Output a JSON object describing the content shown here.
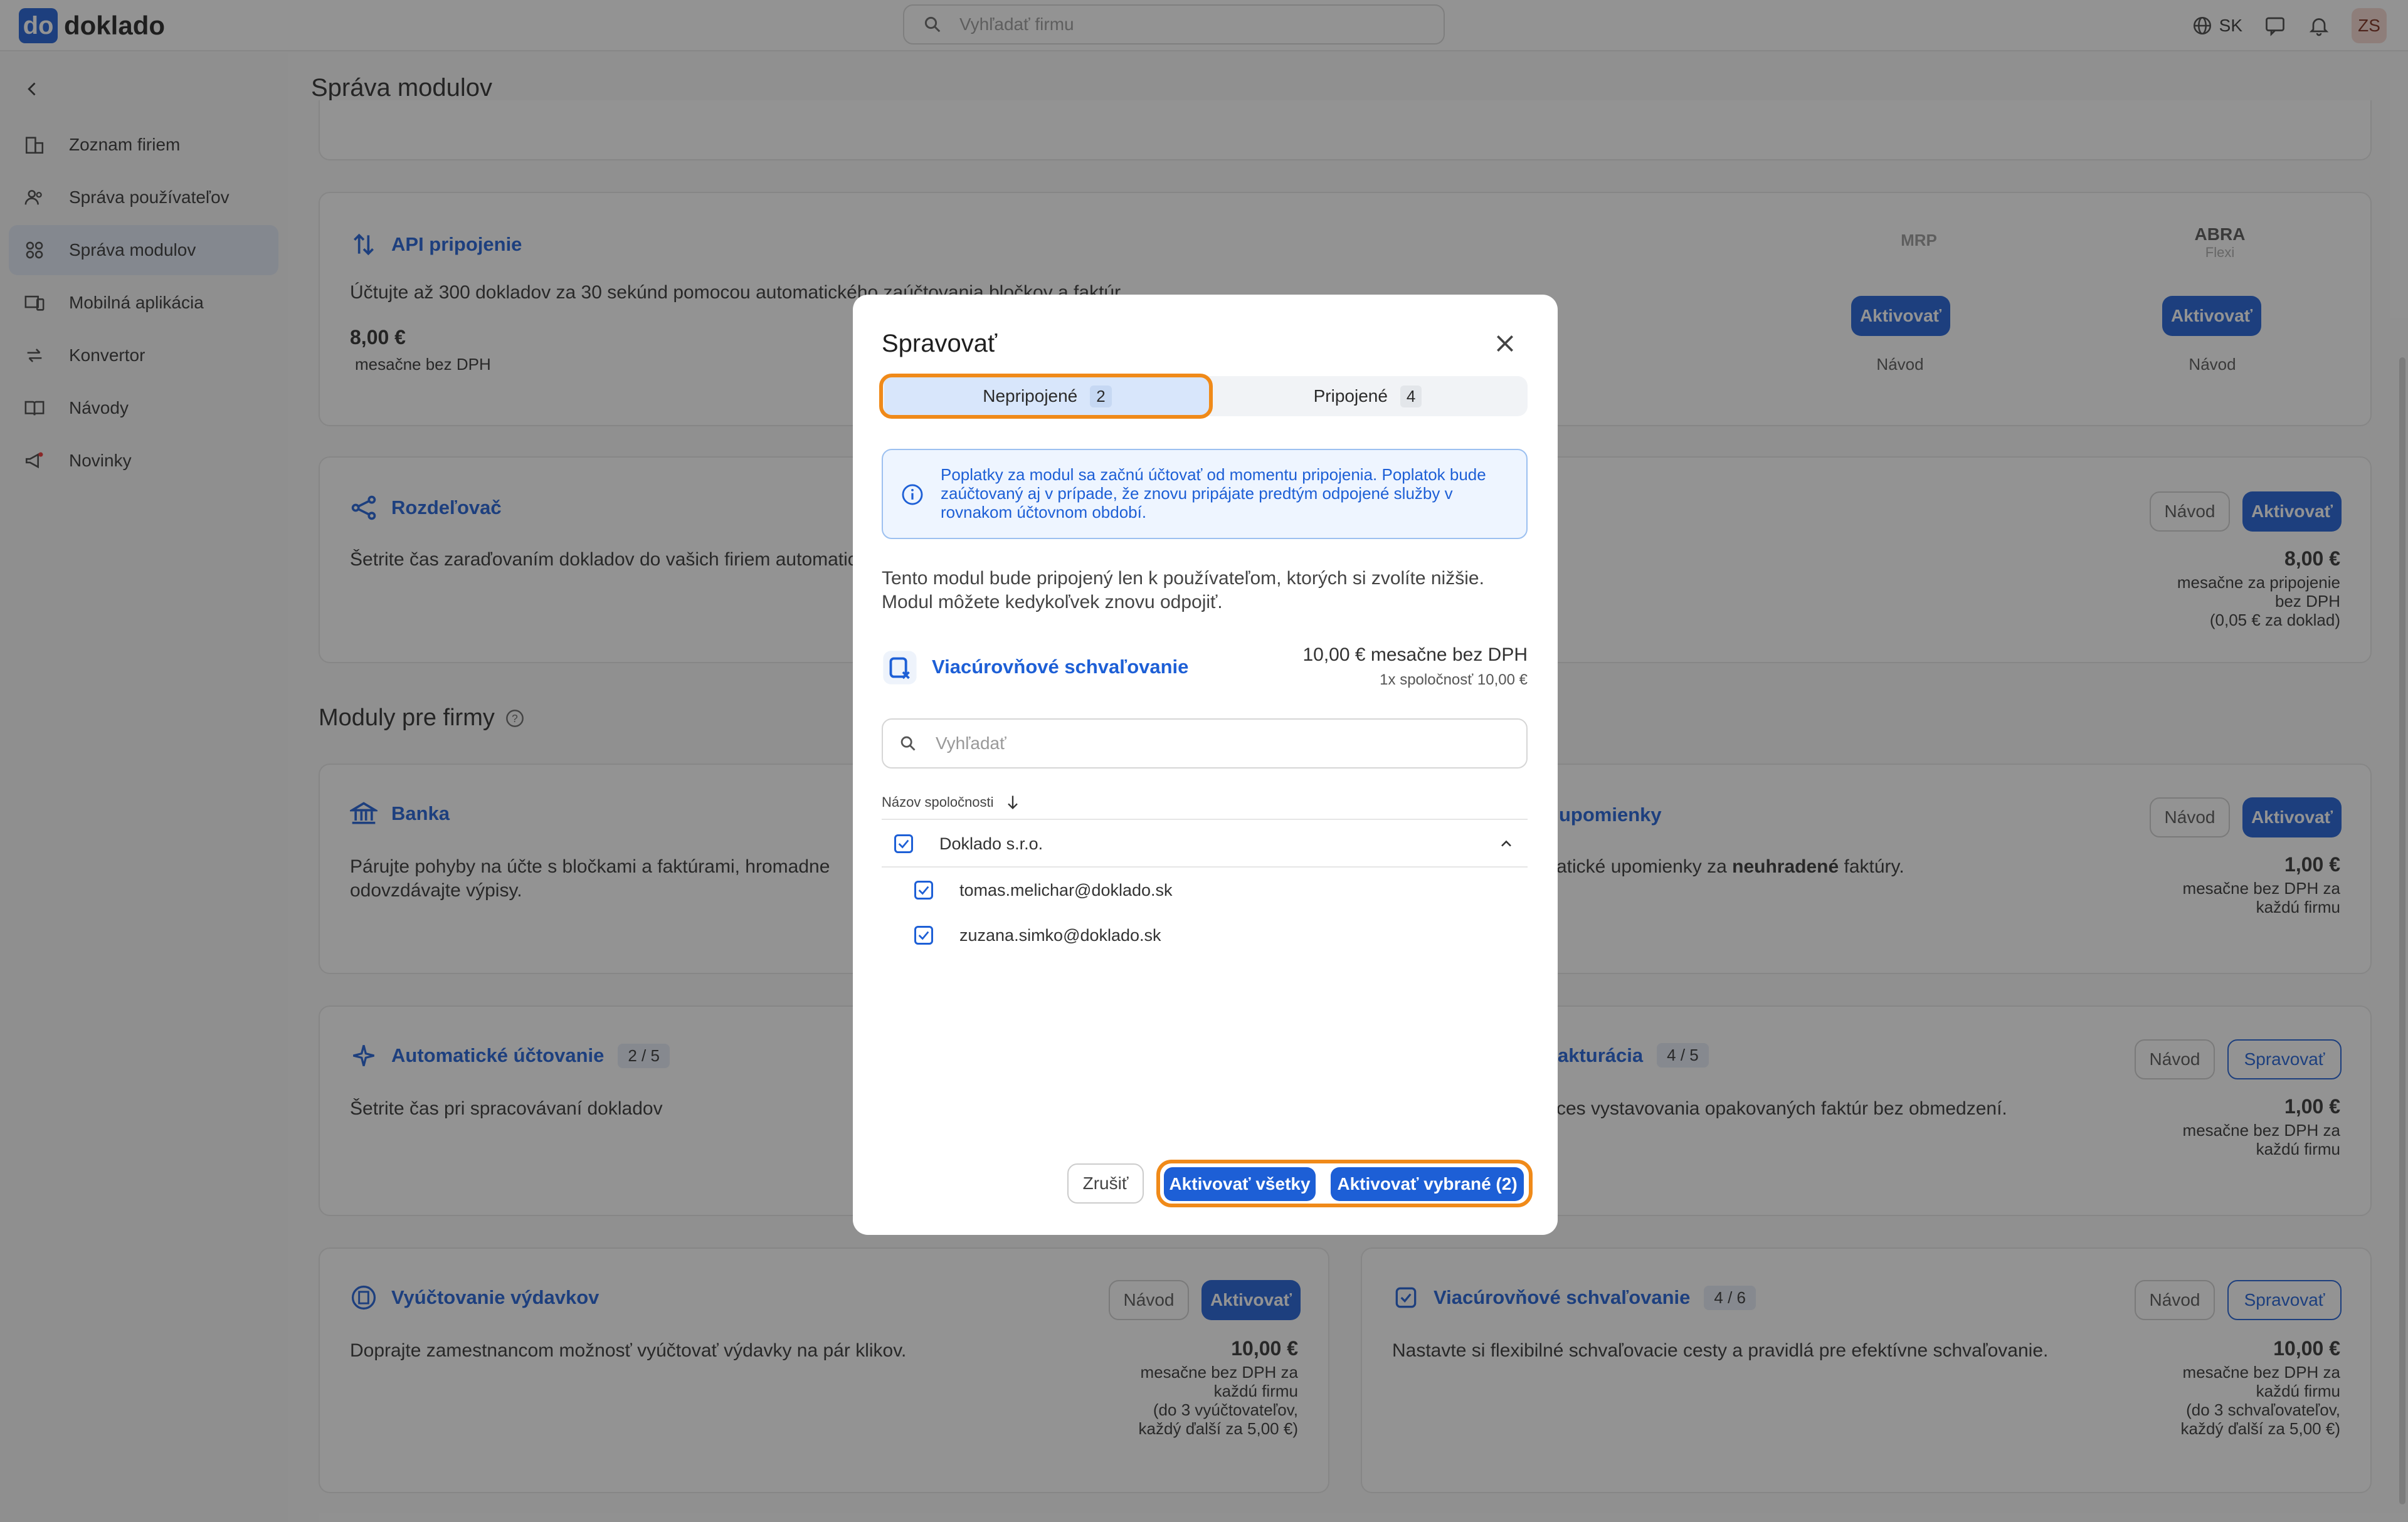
{
  "topbar": {
    "logo_mark": "do",
    "logo_text": "doklado",
    "search_placeholder": "Vyhľadať firmu",
    "lang": "SK",
    "avatar": "ZS"
  },
  "sidebar": {
    "items": [
      {
        "label": "Zoznam firiem",
        "icon": "buildings-icon"
      },
      {
        "label": "Správa používateľov",
        "icon": "users-icon"
      },
      {
        "label": "Správa modulov",
        "icon": "modules-icon",
        "active": true
      },
      {
        "label": "Mobilná aplikácia",
        "icon": "mobile-icon"
      },
      {
        "label": "Konvertor",
        "icon": "convert-icon"
      },
      {
        "label": "Návody",
        "icon": "book-icon"
      },
      {
        "label": "Novinky",
        "icon": "megaphone-icon"
      }
    ]
  },
  "main": {
    "title": "Správa modulov",
    "section_title": "Moduly pre firmy",
    "api": {
      "title": "API pripojenie",
      "desc": "Účtujte až 300 dokladov za 30 sekúnd pomocou automatického zaúčtovania bločkov a faktúr",
      "price": "8,00 €",
      "price_note": "mesačne bez DPH",
      "int1_logo": "MRP",
      "int2_logo": "ABRA",
      "int2_sub": "Flexi",
      "activate": "Aktivovať",
      "guide": "Návod"
    },
    "rozdelovac": {
      "title": "Rozdeľovač",
      "desc": "Šetrite čas zaraďovaním dokladov do vašich firiem automaticky",
      "guide": "Návod",
      "activate": "Aktivovať",
      "price": "8,00 €",
      "price_note1": "mesačne za pripojenie",
      "price_note2": "bez DPH",
      "price_note3": "(0,05 € za doklad)"
    },
    "banka": {
      "title": "Banka",
      "desc1": "Párujte pohyby na účte s bločkami a faktúrami, hromadne",
      "desc2": "odovzdávajte výpisy."
    },
    "upomienky": {
      "title": "upomienky",
      "desc_pre": "atické upomienky za ",
      "desc_bold": "neuhradené",
      "desc_post": " faktúry.",
      "guide": "Návod",
      "activate": "Aktivovať",
      "price": "1,00 €",
      "price_note1": "mesačne bez DPH za",
      "price_note2": "každú firmu"
    },
    "auto": {
      "title": "Automatické účtovanie",
      "badge": "2 / 5",
      "desc": "Šetrite čas pri spracovávaní dokladov"
    },
    "fakturacia": {
      "title": "akturácia",
      "badge": "4 / 5",
      "desc": "ces vystavovania opakovaných faktúr bez obmedzení.",
      "guide": "Návod",
      "manage": "Spravovať",
      "price": "1,00 €",
      "price_note1": "mesačne bez DPH za",
      "price_note2": "každú firmu"
    },
    "vydavky": {
      "title": "Vyúčtovanie výdavkov",
      "desc": "Doprajte zamestnancom možnosť vyúčtovať výdavky na pár klikov.",
      "guide": "Návod",
      "activate": "Aktivovať",
      "price": "10,00 €",
      "price_note1": "mesačne bez DPH za",
      "price_note2": "každú firmu",
      "price_note3": "(do 3 vyúčtovateľov,",
      "price_note4": "každý ďalší za 5,00 €)"
    },
    "schvalovanie": {
      "title": "Viacúrovňové schvaľovanie",
      "badge": "4 / 6",
      "desc": "Nastavte si flexibilné schvaľovacie cesty a pravidlá pre efektívne schvaľovanie.",
      "guide": "Návod",
      "manage": "Spravovať",
      "price": "10,00 €",
      "price_note1": "mesačne bez DPH za",
      "price_note2": "každú firmu",
      "price_note3": "(do 3 schvaľovateľov,",
      "price_note4": "každý ďalší za 5,00 €)"
    }
  },
  "modal": {
    "title": "Spravovať",
    "tab1_label": "Nepripojené",
    "tab1_count": "2",
    "tab2_label": "Pripojené",
    "tab2_count": "4",
    "info": "Poplatky za modul sa začnú účtovať od momentu pripojenia. Poplatok bude zaúčtovaný aj v prípade, že znovu pripájate predtým odpojené služby v rovnakom účtovnom období.",
    "desc": "Tento modul bude pripojený len k používateľom, ktorých si zvolíte nižšie. Modul môžete kedykoľvek znovu odpojiť.",
    "module_name": "Viacúrovňové schvaľovanie",
    "module_price": "10,00 €  mesačne bez DPH",
    "module_sub": "1x spoločnosť 10,00 €",
    "search_placeholder": "Vyhľadať",
    "col_header": "Názov spoločnosti",
    "company": "Doklado s.r.o.",
    "users": [
      "tomas.melichar@doklado.sk",
      "zuzana.simko@doklado.sk"
    ],
    "cancel": "Zrušiť",
    "activate_all": "Aktivovať všetky",
    "activate_selected": "Aktivovať vybrané (2)"
  },
  "colors": {
    "accent": "#1d5fd6",
    "highlight": "#f08a19"
  }
}
